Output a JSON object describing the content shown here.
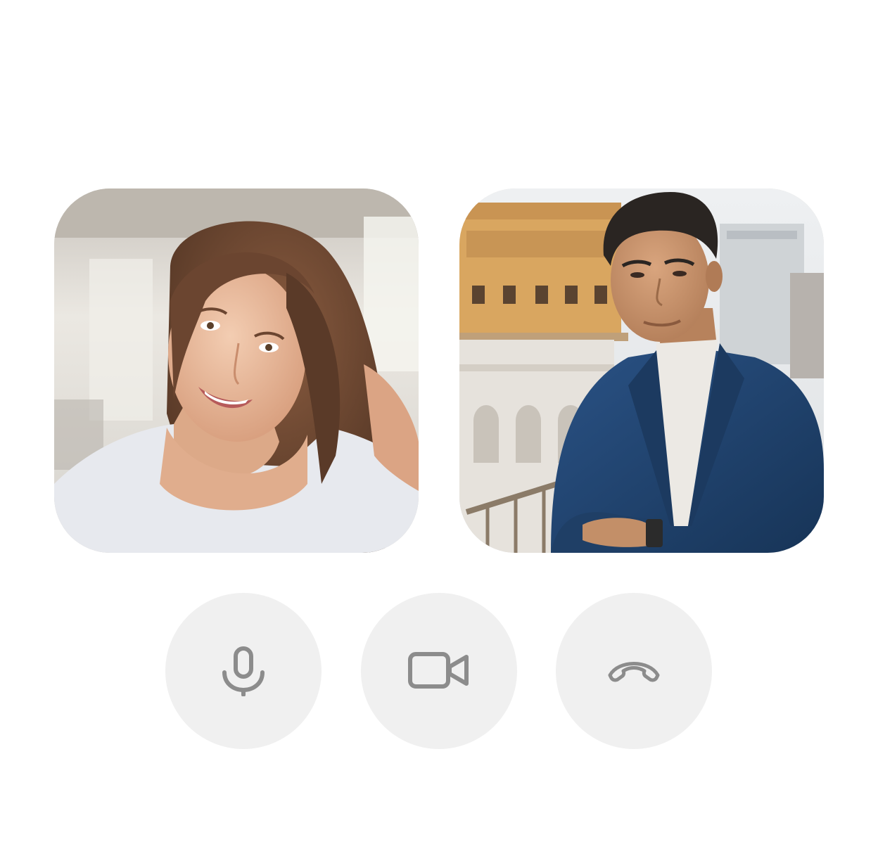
{
  "call": {
    "participants": [
      {
        "id": "participant-1",
        "avatar": "woman-portrait",
        "palette": {
          "background": "#e9e6e0",
          "hair": "#6b4530",
          "skin": "#e9b99a",
          "shirt": "#e7e9ee"
        }
      },
      {
        "id": "participant-2",
        "avatar": "man-portrait",
        "palette": {
          "background": "#dcd3c6",
          "building": "#d9a660",
          "hair": "#2a2522",
          "skin": "#c9956e",
          "jacket": "#1f3f66",
          "turtleneck": "#ece9e4"
        }
      }
    ]
  },
  "controls": {
    "background": "#f0f0f0",
    "icon_color": "#8c8c8c",
    "buttons": [
      {
        "id": "mute",
        "icon": "microphone-icon"
      },
      {
        "id": "camera",
        "icon": "video-camera-icon"
      },
      {
        "id": "hangup",
        "icon": "phone-hangup-icon"
      }
    ]
  }
}
